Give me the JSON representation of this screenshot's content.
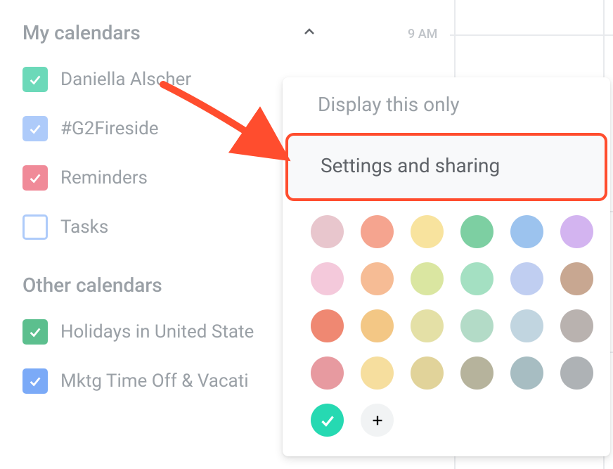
{
  "sidebar": {
    "my_calendars_title": "My calendars",
    "other_calendars_title": "Other calendars",
    "my_calendars": [
      {
        "label": "Daniella Alscher",
        "checked": true,
        "color": "#6cd9b9"
      },
      {
        "label": "#G2Fireside",
        "checked": true,
        "color": "#aecbfa"
      },
      {
        "label": "Reminders",
        "checked": true,
        "color": "#f08a98"
      },
      {
        "label": "Tasks",
        "checked": false,
        "color": "#aecbfa"
      }
    ],
    "other_calendars": [
      {
        "label": "Holidays in United State",
        "checked": true,
        "color": "#5cbf8e"
      },
      {
        "label": "Mktg Time Off & Vacati",
        "checked": true,
        "color": "#7baaf7"
      }
    ]
  },
  "time": {
    "label": "9 AM"
  },
  "popup": {
    "display_only": "Display this only",
    "settings_sharing": "Settings and sharing",
    "colors": [
      "#e8c6cd",
      "#f5a48f",
      "#f8e39e",
      "#7dcfa2",
      "#9cc3ee",
      "#d3b4f0",
      "#f4c9db",
      "#f6bc95",
      "#dae6a1",
      "#a4e0c2",
      "#c0cef1",
      "#c8a791",
      "#ef8872",
      "#f3c785",
      "#e4e0a6",
      "#b3dbc7",
      "#c1d5e0",
      "#b9b2af",
      "#e79aa0",
      "#f6de9e",
      "#e1d39a",
      "#b6b39c",
      "#a7bdc2",
      "#aeb2b5"
    ],
    "selected_color": "#26d9b2"
  }
}
